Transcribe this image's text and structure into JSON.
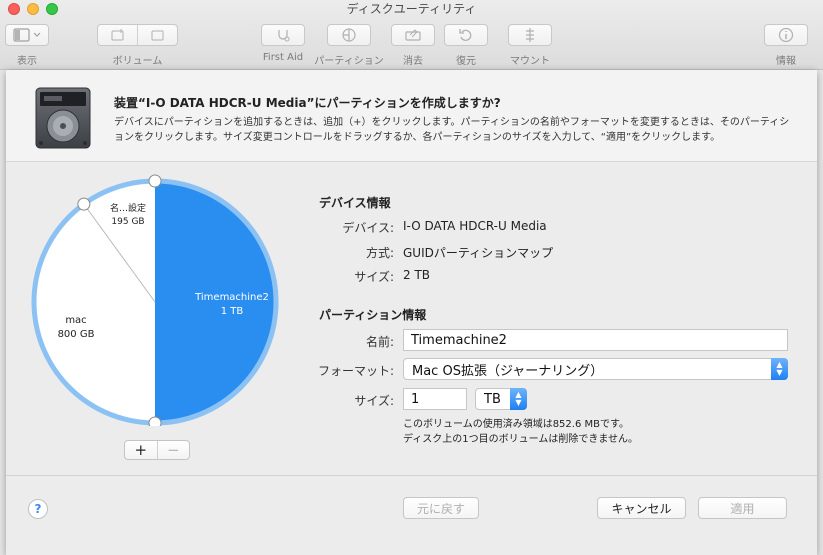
{
  "window": {
    "title": "ディスクユーティリティ"
  },
  "toolbar": {
    "view_label": "表示",
    "volume_label": "ボリューム",
    "first_aid_label": "First Aid",
    "partition_label": "パーティション",
    "erase_label": "消去",
    "restore_label": "復元",
    "mount_label": "マウント",
    "info_label": "情報"
  },
  "sheet": {
    "title": "装置“I-O DATA HDCR-U Media”にパーティションを作成しますか?",
    "description": "デバイスにパーティションを追加するときは、追加（+）をクリックします。パーティションの名前やフォーマットを変更するときは、そのパーティションをクリックします。サイズ変更コントロールをドラッグするか、各パーティションのサイズを入力して、“適用”をクリックします。"
  },
  "pie": {
    "slices": [
      {
        "name": "Timemachine2",
        "size": "1 TB",
        "fraction": 0.5,
        "color": "#2a8ef0"
      },
      {
        "name": "mac",
        "size": "800 GB",
        "fraction": 0.4,
        "color": "#ffffff"
      },
      {
        "name": "名…設定",
        "size": "195 GB",
        "fraction": 0.1,
        "color": "#ffffff"
      }
    ],
    "add_label": "+",
    "remove_label": "−"
  },
  "device_info": {
    "section_title": "デバイス情報",
    "device_label": "デバイス:",
    "device_value": "I-O DATA HDCR-U Media",
    "scheme_label": "方式:",
    "scheme_value": "GUIDパーティションマップ",
    "size_label": "サイズ:",
    "size_value": "2 TB"
  },
  "partition_info": {
    "section_title": "パーティション情報",
    "name_label": "名前:",
    "name_value": "Timemachine2",
    "format_label": "フォーマット:",
    "format_value": "Mac OS拡張（ジャーナリング）",
    "size_label": "サイズ:",
    "size_value": "1",
    "unit_value": "TB",
    "note_line1": "このボリュームの使用済み領域は852.6 MBです。",
    "note_line2": "ディスク上の1つ目のボリュームは削除できません。"
  },
  "footer": {
    "help_label": "?",
    "revert_label": "元に戻す",
    "cancel_label": "キャンセル",
    "apply_label": "適用"
  },
  "colors": {
    "accent": "#2a8ef0",
    "pie_ring": "#8cc2f3"
  }
}
